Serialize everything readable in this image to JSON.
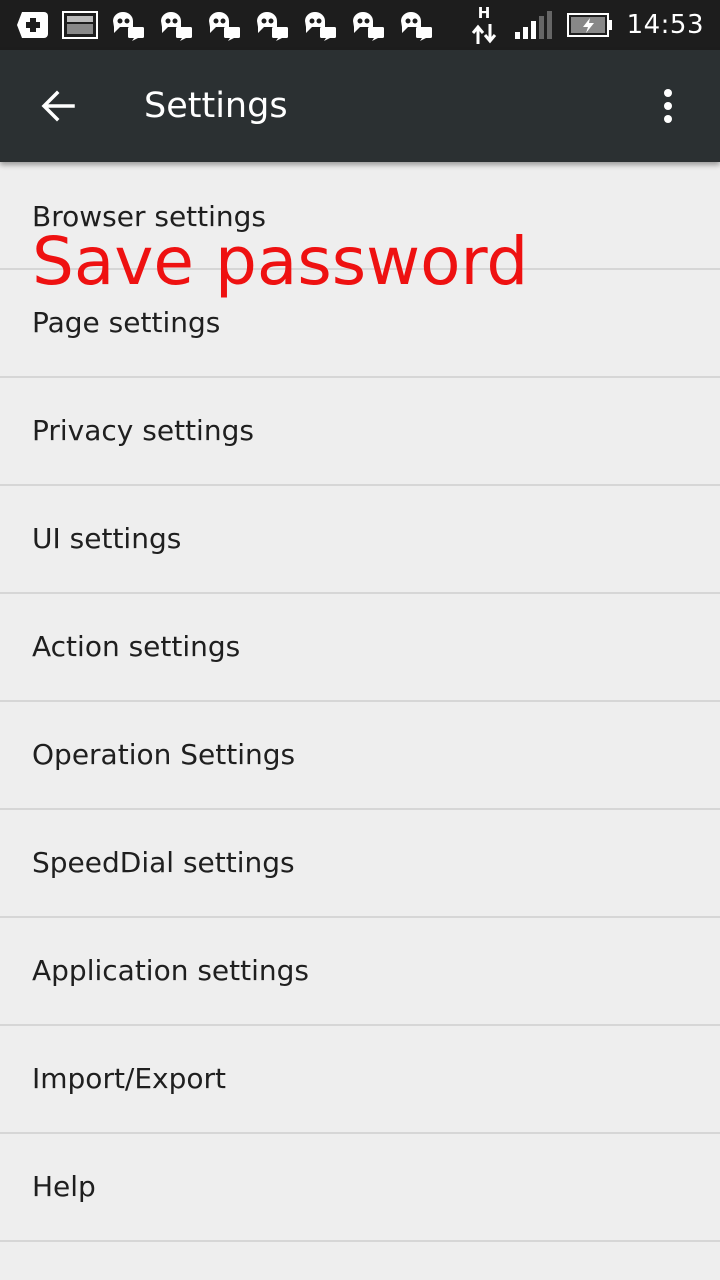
{
  "status_bar": {
    "clock": "14:53",
    "network_type": "H",
    "notification_icons": [
      "add-box-icon",
      "image-icon",
      "chat-icon",
      "chat-icon",
      "chat-icon",
      "chat-icon",
      "chat-icon",
      "chat-icon",
      "chat-icon"
    ],
    "indicator_icons": [
      "data-transfer-icon",
      "signal-icon",
      "battery-charging-icon"
    ]
  },
  "app_bar": {
    "title": "Settings",
    "back_icon": "arrow-back-icon",
    "overflow_icon": "more-vert-icon"
  },
  "overlay": {
    "text": "Save password",
    "color": "#ee1111"
  },
  "settings": {
    "items": [
      {
        "label": "Browser settings"
      },
      {
        "label": "Page settings"
      },
      {
        "label": "Privacy settings"
      },
      {
        "label": "UI settings"
      },
      {
        "label": "Action settings"
      },
      {
        "label": "Operation Settings"
      },
      {
        "label": "SpeedDial settings"
      },
      {
        "label": "Application settings"
      },
      {
        "label": "Import/Export"
      },
      {
        "label": "Help"
      }
    ]
  },
  "colors": {
    "status_bar_bg": "#1d1d1d",
    "app_bar_bg": "#2b3032",
    "list_bg": "#eeeeee",
    "divider": "#d6d6d6",
    "text": "#1f1f1f"
  }
}
